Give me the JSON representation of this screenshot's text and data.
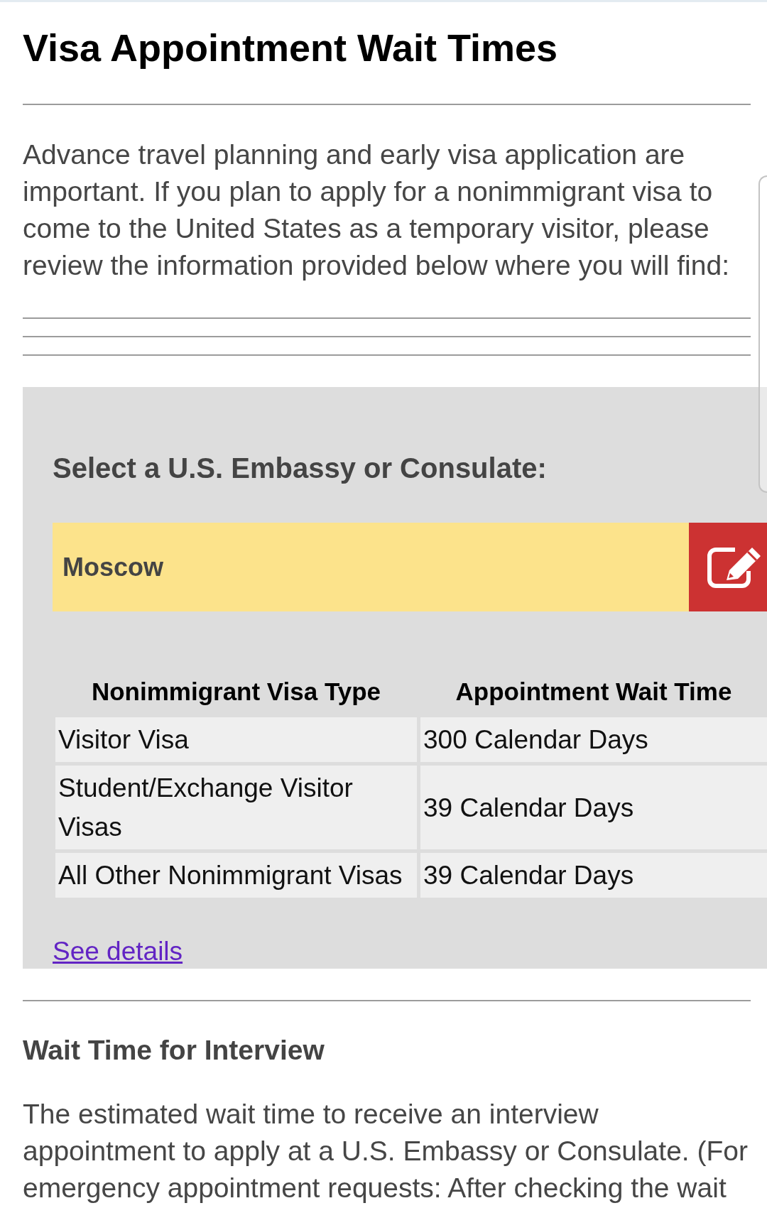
{
  "title": "Visa Appointment Wait Times",
  "intro": "Advance travel planning and early visa application are important. If you plan to apply for a nonimmigrant visa to come to the United States as a temporary visitor, please review the information provided below where you will find:",
  "selector": {
    "label": "Select a U.S. Embassy or Consulate:",
    "value": "Moscow"
  },
  "table": {
    "columns": [
      "Nonimmigrant Visa Type",
      "Appointment Wait Time"
    ],
    "rows": [
      [
        "Visitor Visa",
        "300 Calendar Days"
      ],
      [
        "Student/Exchange Visitor Visas",
        "39 Calendar Days"
      ],
      [
        "All Other Nonimmigrant Visas",
        "39 Calendar Days"
      ]
    ]
  },
  "link": "See details",
  "section": {
    "heading": "Wait Time for Interview",
    "text": "The estimated wait time to receive an interview appointment to apply at a U.S. Embassy or Consulate. (For emergency appointment requests: After checking the wait"
  }
}
